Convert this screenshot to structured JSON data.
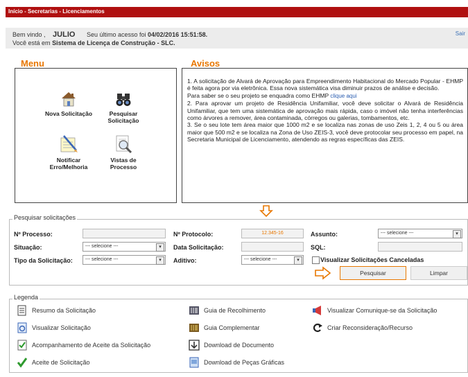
{
  "header": {
    "breadcrumb": "Início - Secretarias - Licenciamentos"
  },
  "user_bar": {
    "welcome": "Bem vindo ,",
    "user": "JULIO",
    "last_access_prefix": "Seu último acesso foi",
    "last_access": "04/02/2016 15:51:58",
    "location_prefix": "Você está em",
    "system": "Sistema de Licença de Construção - SLC",
    "logout": "Sair"
  },
  "menu": {
    "title": "Menu",
    "items": [
      {
        "label": "Nova Solicitação",
        "icon": "house-icon"
      },
      {
        "label": "Pesquisar Solicitação",
        "icon": "binoculars-icon"
      },
      {
        "label": "Notificar Erro/Melhoria",
        "icon": "notepad-pencil-icon"
      },
      {
        "label": "Vistas de Processo",
        "icon": "magnifier-document-icon"
      }
    ]
  },
  "avisos": {
    "title": "Avisos",
    "p1": "1. A solicitação de Alvará de Aprovação para Empreendimento Habitacional do Mercado Popular - EHMP é feita agora por via eletrônica. Essa nova sistemática visa diminuir prazos de análise e decisão.",
    "p2_prefix": "Para saber se o seu projeto se enquadra como EHMP",
    "p2_link": "clique aqui",
    "p3": "2. Para aprovar um projeto de Residência Unifamiliar, você deve solicitar o Alvará de Residência Unifamiliar, que tem uma sistemática de aprovação mais rápida, caso o imóvel não tenha interferências como árvores a remover, área contaminada, córregos ou galerias, tombamentos, etc.",
    "p4": "3. Se o seu lote tem área maior que 1000 m2 e se localiza nas zonas de uso Zeis 1, 2, 4 ou 5 ou área maior que 500 m2 e se localiza na Zona de Uso ZEIS-3, você deve protocolar seu processo em papel, na Secretaria Municipal de Licenciamento, atendendo as regras específicas das ZEIS."
  },
  "search": {
    "legend": "Pesquisar solicitações",
    "processo_label": "Nº Processo:",
    "protocolo_label": "Nº Protocolo:",
    "protocolo_value": "12.345-16",
    "assunto_label": "Assunto:",
    "assunto_value": "--- selecione ---",
    "situacao_label": "Situação:",
    "situacao_value": "--- selecione ---",
    "data_label": "Data Solicitação:",
    "sql_label": "SQL:",
    "tipo_label": "Tipo da Solicitação:",
    "tipo_value": "--- selecione ---",
    "aditivo_label": "Aditivo:",
    "aditivo_value": "--- selecione ---",
    "canceladas_label": "Visualizar Solicitações Canceladas",
    "pesquisar": "Pesquisar",
    "limpar": "Limpar"
  },
  "legenda": {
    "title": "Legenda",
    "items": [
      {
        "label": "Resumo da Solicitação",
        "icon": "summary-document-icon"
      },
      {
        "label": "Guia de Recolhimento",
        "icon": "barcode-guide-icon"
      },
      {
        "label": "Visualizar Comunique-se da Solicitação",
        "icon": "megaphone-icon"
      },
      {
        "label": "Visualizar Solicitação",
        "icon": "view-document-icon"
      },
      {
        "label": "Guia Complementar",
        "icon": "complementary-guide-icon"
      },
      {
        "label": "Criar Reconsideração/Recurso",
        "icon": "refresh-arrow-icon"
      },
      {
        "label": "Acompanhamento de Aceite da Solicitação",
        "icon": "checklist-icon"
      },
      {
        "label": "Download de Documento",
        "icon": "download-document-icon"
      },
      {
        "label": "Aceite de Solicitação",
        "icon": "checkmark-icon"
      },
      {
        "label": "Download de Peças Gráficas",
        "icon": "graphic-parts-icon"
      }
    ]
  },
  "colors": {
    "header_red": "#b01010",
    "accent_orange": "#e87700",
    "link_blue": "#2a5db0"
  }
}
